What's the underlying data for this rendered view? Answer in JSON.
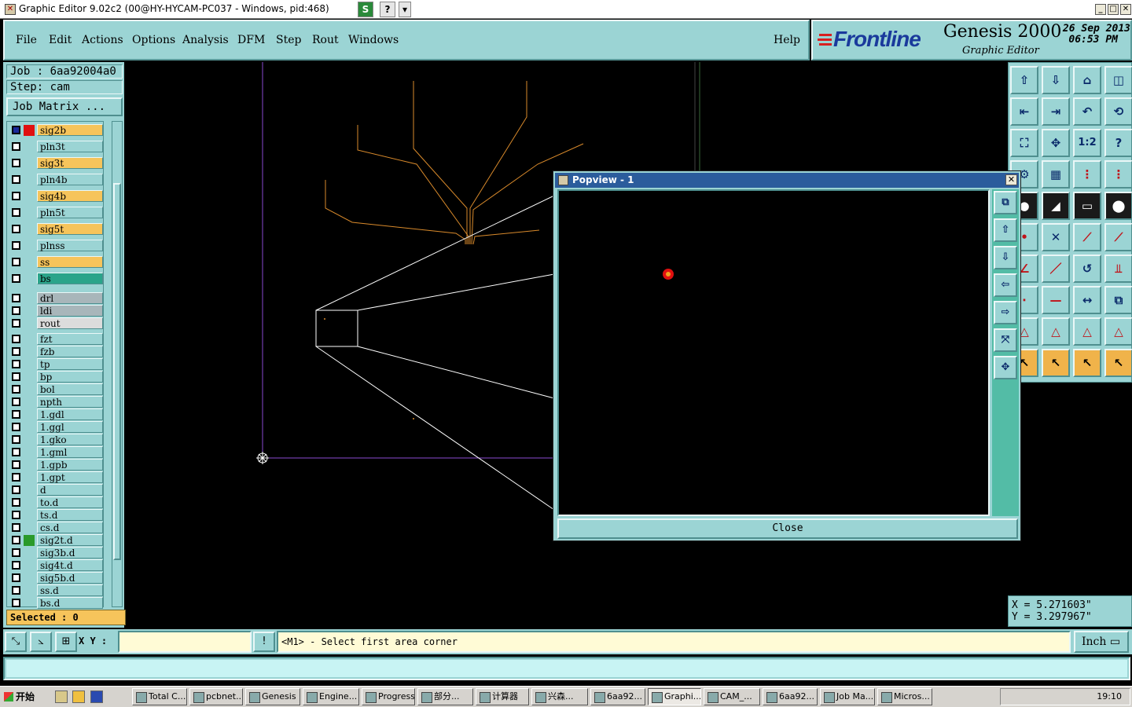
{
  "window": {
    "title": "Graphic Editor 9.02c2 (00@HY-HYCAM-PC037 - Windows, pid:468)"
  },
  "menu": [
    "File",
    "Edit",
    "Actions",
    "Options",
    "Analysis",
    "DFM",
    "Step",
    "Rout",
    "Windows"
  ],
  "help_label": "Help",
  "brand": {
    "logo": "Frontline",
    "product": "Genesis 2000",
    "subtitle": "Graphic Editor",
    "date": "26 Sep 2013",
    "time": "06:53 PM"
  },
  "job": {
    "job_label": "Job : 6aa92004a0",
    "step_label": "Step: cam",
    "matrix_button": "Job Matrix ..."
  },
  "layers": [
    {
      "name": "sig2b",
      "color": "#f6c45b",
      "marker": "#e01010",
      "active": true
    },
    {
      "name": "pln3t",
      "color": "#9bd4d4"
    },
    {
      "name": "sig3t",
      "color": "#f6c45b"
    },
    {
      "name": "pln4b",
      "color": "#9bd4d4"
    },
    {
      "name": "sig4b",
      "color": "#f6c45b"
    },
    {
      "name": "pln5t",
      "color": "#9bd4d4"
    },
    {
      "name": "sig5t",
      "color": "#f6c45b"
    },
    {
      "name": "plnss",
      "color": "#9bd4d4"
    },
    {
      "name": "ss",
      "color": "#f6c45b"
    },
    {
      "name": "bs",
      "color": "#2aa48a"
    },
    {
      "name": "drl",
      "color": "#a8b6ba"
    },
    {
      "name": "ldi",
      "color": "#a8b6ba"
    },
    {
      "name": "rout",
      "color": "#dcdcdc"
    },
    {
      "name": "fzt",
      "color": "#9bd4d4"
    },
    {
      "name": "fzb",
      "color": "#9bd4d4"
    },
    {
      "name": "tp",
      "color": "#9bd4d4"
    },
    {
      "name": "bp",
      "color": "#9bd4d4"
    },
    {
      "name": "bol",
      "color": "#9bd4d4"
    },
    {
      "name": "npth",
      "color": "#9bd4d4"
    },
    {
      "name": "1.gdl",
      "color": "#9bd4d4"
    },
    {
      "name": "1.ggl",
      "color": "#9bd4d4"
    },
    {
      "name": "1.gko",
      "color": "#9bd4d4"
    },
    {
      "name": "1.gml",
      "color": "#9bd4d4"
    },
    {
      "name": "1.gpb",
      "color": "#9bd4d4"
    },
    {
      "name": "1.gpt",
      "color": "#9bd4d4"
    },
    {
      "name": "d",
      "color": "#9bd4d4"
    },
    {
      "name": "to.d",
      "color": "#9bd4d4"
    },
    {
      "name": "ts.d",
      "color": "#9bd4d4"
    },
    {
      "name": "cs.d",
      "color": "#9bd4d4"
    },
    {
      "name": "sig2t.d",
      "color": "#9bd4d4",
      "marker": "#2a9a2a"
    },
    {
      "name": "sig3b.d",
      "color": "#9bd4d4"
    },
    {
      "name": "sig4t.d",
      "color": "#9bd4d4"
    },
    {
      "name": "sig5b.d",
      "color": "#9bd4d4"
    },
    {
      "name": "ss.d",
      "color": "#9bd4d4"
    },
    {
      "name": "bs.d",
      "color": "#9bd4d4"
    }
  ],
  "selected_label": "Selected : 0",
  "popview": {
    "title": "Popview - 1",
    "close_button": "Close"
  },
  "coords": {
    "x": "X = 5.271603\"",
    "y": "Y = 3.297967\""
  },
  "status": {
    "xy_label": "X Y :",
    "xy_value": "",
    "prompt": "<M1> - Select first area corner",
    "units": "Inch"
  },
  "taskbar": {
    "start": "开始",
    "tasks": [
      "Total C...",
      "pcbnet...",
      "Genesis",
      "Engine...",
      "Progress",
      "部分...",
      "计算器",
      "兴森...",
      "6aa92...",
      "Graphi...",
      "CAM_...",
      "6aa92...",
      "Job Ma...",
      "Micros..."
    ],
    "clock": "19:10"
  },
  "colors": {
    "panel": "#9bd4d4",
    "accent": "#f6c45b",
    "trace": "#d98a2b"
  }
}
